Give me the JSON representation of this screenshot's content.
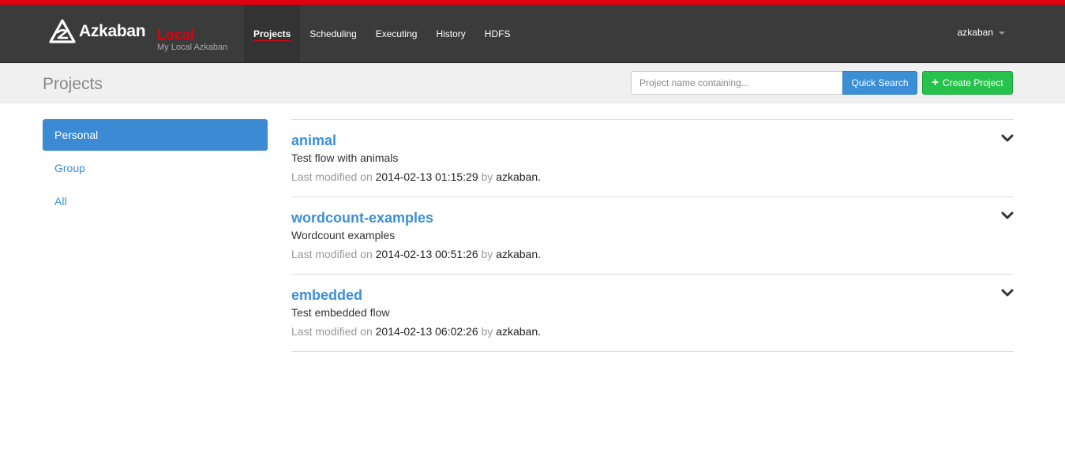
{
  "brand": {
    "name": "Azkaban",
    "env": "Local",
    "subtitle": "My Local Azkaban",
    "accent_color": "#e0000f",
    "icon": "azkaban-logo-icon"
  },
  "nav": {
    "items": [
      {
        "label": "Projects",
        "active": true
      },
      {
        "label": "Scheduling",
        "active": false
      },
      {
        "label": "Executing",
        "active": false
      },
      {
        "label": "History",
        "active": false
      },
      {
        "label": "HDFS",
        "active": false
      }
    ],
    "user": "azkaban"
  },
  "header": {
    "title": "Projects",
    "search_placeholder": "Project name containing...",
    "search_value": "",
    "search_button": "Quick Search",
    "create_button": "Create Project",
    "search_color": "#3c8fd6",
    "create_color": "#27c24c"
  },
  "sidebar": {
    "items": [
      {
        "label": "Personal",
        "active": true
      },
      {
        "label": "Group",
        "active": false
      },
      {
        "label": "All",
        "active": false
      }
    ]
  },
  "projects": [
    {
      "name": "animal",
      "description": "Test flow with animals",
      "modified_prefix": "Last modified on",
      "modified": "2014-02-13 01:15:29",
      "by_prefix": "by",
      "user": "azkaban",
      "suffix": "."
    },
    {
      "name": "wordcount-examples",
      "description": "Wordcount examples",
      "modified_prefix": "Last modified on",
      "modified": "2014-02-13 00:51:26",
      "by_prefix": "by",
      "user": "azkaban",
      "suffix": "."
    },
    {
      "name": "embedded",
      "description": "Test embedded flow",
      "modified_prefix": "Last modified on",
      "modified": "2014-02-13 06:02:26",
      "by_prefix": "by",
      "user": "azkaban",
      "suffix": "."
    }
  ]
}
